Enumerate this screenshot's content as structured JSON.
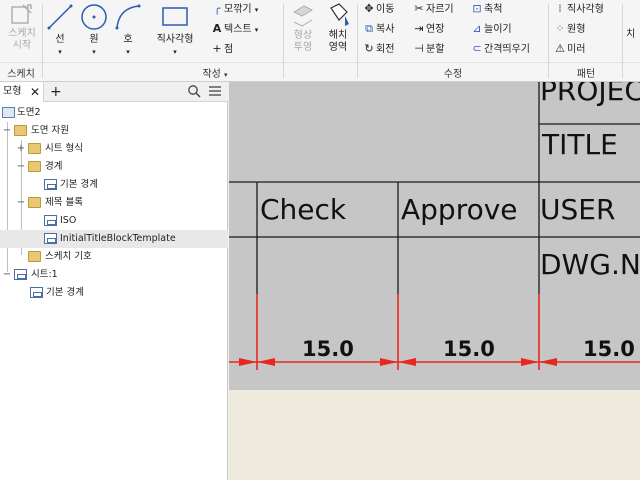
{
  "ribbon": {
    "sketch_start": "스케치\n시작",
    "sketch_panel": "스케치",
    "line": "선",
    "circle": "원",
    "arc": "호",
    "rectangle": "직사각형",
    "fillet": "모깎기",
    "text": "텍스트",
    "point": "점",
    "create_panel": "작성",
    "project_geometry": "형상\n투영",
    "hatch": "해치\n영역",
    "move": "이동",
    "copy": "복사",
    "rotate": "회전",
    "trim": "자르기",
    "extend": "연장",
    "split": "분할",
    "scale": "축척",
    "stretch": "늘이기",
    "offset": "간격띄우기",
    "modify_panel": "수정",
    "rect_pattern": "직사각형",
    "circ_pattern": "원형",
    "mirror": "미러",
    "pattern_panel": "패턴",
    "partial_label": "치"
  },
  "browser": {
    "tab_model": "모형",
    "tree": [
      {
        "label": "도면2",
        "icon": "drawing-icon"
      },
      {
        "label": "도면 자원",
        "icon": "folder-icon"
      },
      {
        "label": "시트 형식",
        "icon": "folder-icon"
      },
      {
        "label": "경계",
        "icon": "folder-icon"
      },
      {
        "label": "기본 경계",
        "icon": "border-icon"
      },
      {
        "label": "제목 블록",
        "icon": "folder-icon"
      },
      {
        "label": "ISO",
        "icon": "titleblock-icon"
      },
      {
        "label": "InitialTitleBlockTemplate",
        "icon": "titleblock-icon"
      },
      {
        "label": "스케치 기호",
        "icon": "folder-icon"
      },
      {
        "label": "시트:1",
        "icon": "sheet-icon"
      },
      {
        "label": "기본 경계",
        "icon": "border-icon"
      }
    ]
  },
  "canvas": {
    "cells": {
      "project": "PROJEC",
      "title": "TITLE",
      "check": "Check",
      "approve": "Approve",
      "user": "USER",
      "dwg": "DWG.N"
    },
    "dimensions": [
      "15.0",
      "15.0",
      "15.0"
    ]
  },
  "colors": {
    "ribbon_bg": "#f5f5f5",
    "browser_bg": "#ffffff",
    "titleblock_bg": "#c6c6c6",
    "paper_bg": "#eeeadd",
    "dimension": "#e8281e",
    "icon_blue": "#2a5db0"
  }
}
